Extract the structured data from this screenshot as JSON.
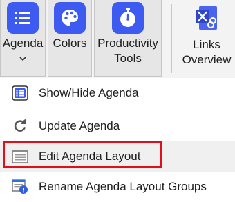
{
  "ribbon": {
    "agenda_label": "Agenda",
    "colors_label": "Colors",
    "productivity_line1": "Productivity",
    "productivity_line2": "Tools",
    "links_line1": "Links",
    "links_line2": "Overview"
  },
  "menu": {
    "items": [
      {
        "label": "Show/Hide Agenda",
        "icon": "list-icon"
      },
      {
        "label": "Update Agenda",
        "icon": "refresh-icon"
      },
      {
        "label": "Edit Agenda Layout",
        "icon": "layout-icon"
      },
      {
        "label": "Rename Agenda Layout Groups",
        "icon": "rename-groups-icon"
      }
    ]
  },
  "colors": {
    "accent": "#3d5af1",
    "highlight_box": "#e0101a"
  }
}
